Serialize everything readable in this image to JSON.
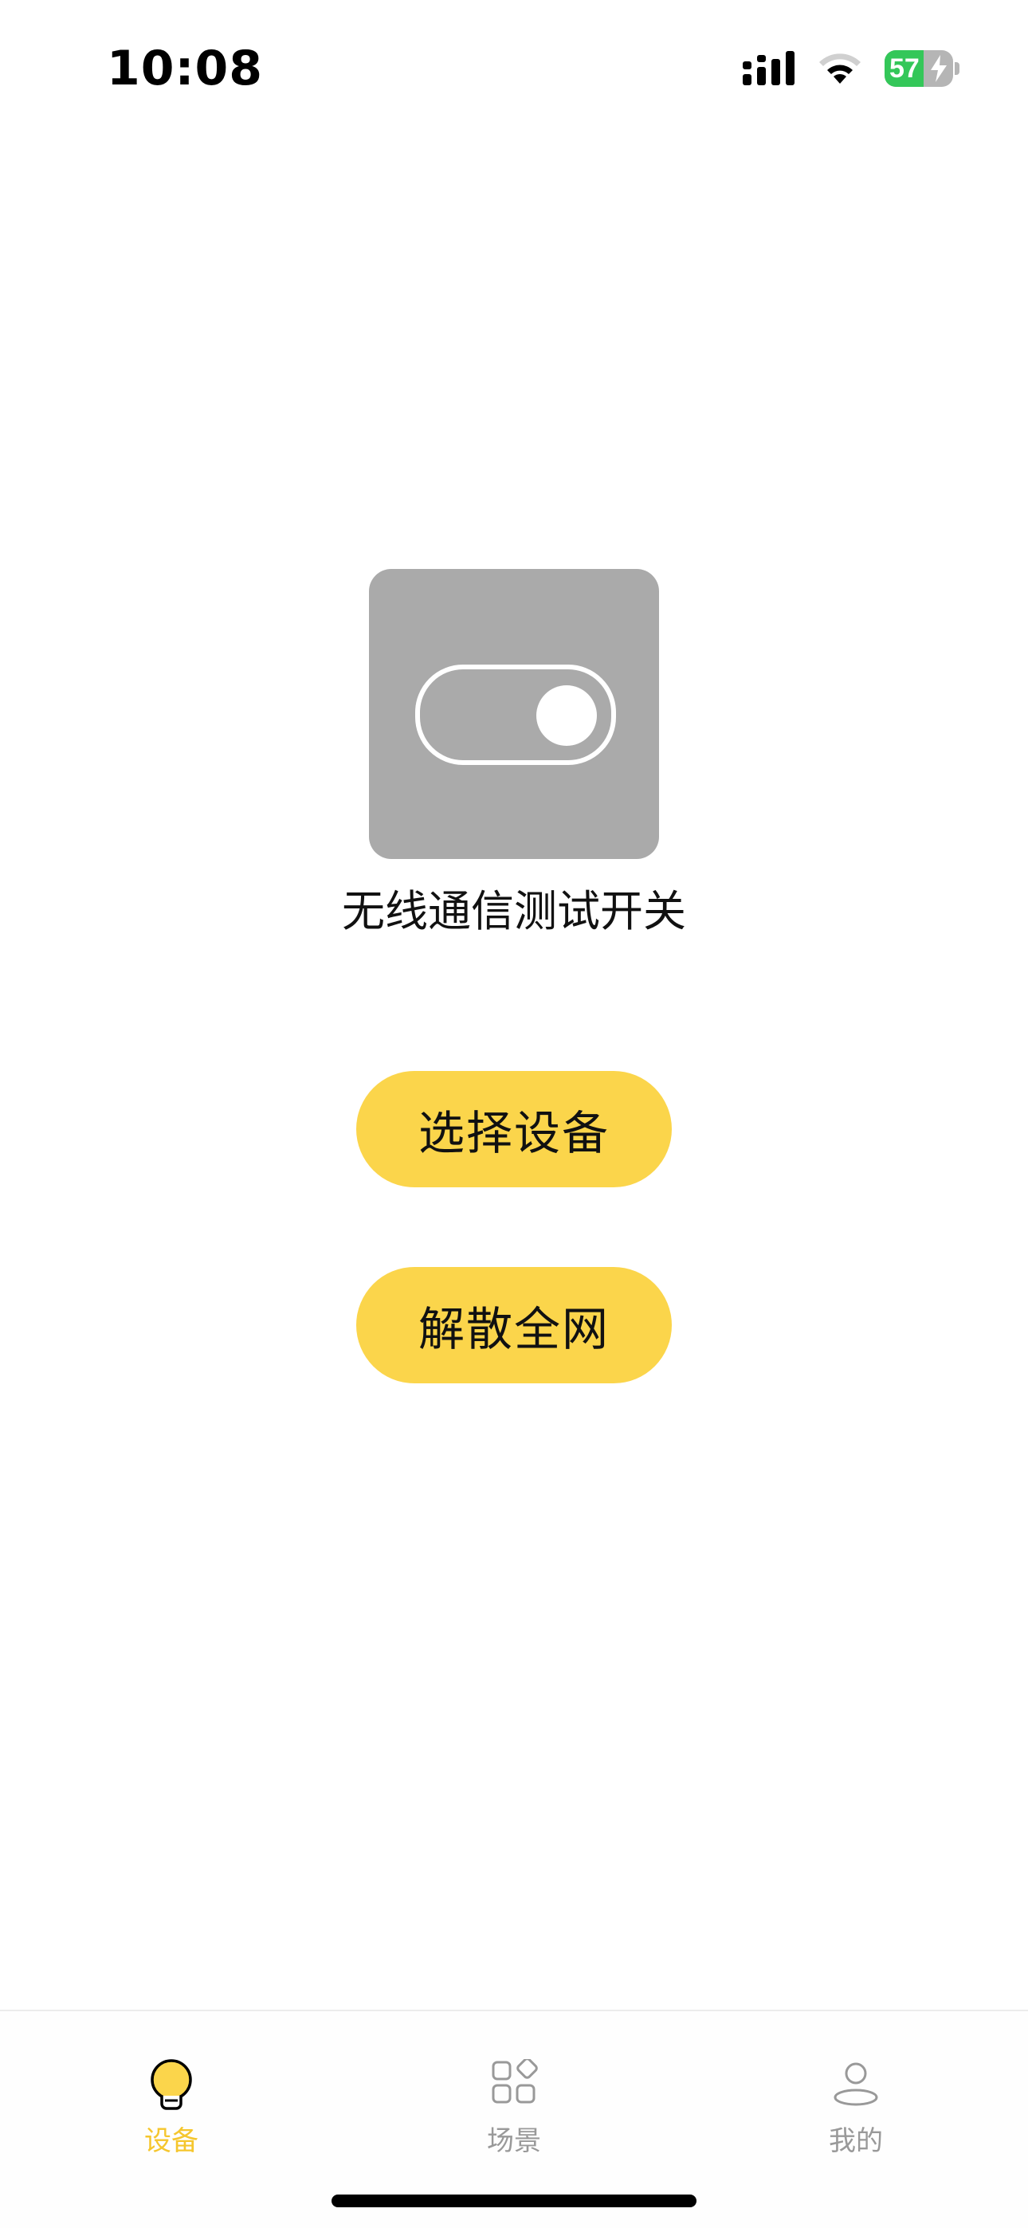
{
  "status_bar": {
    "time": "10:08",
    "battery_level": "57",
    "battery_fraction": 0.57,
    "icons": [
      "signal-icon",
      "wifi-icon",
      "battery-charging-icon"
    ]
  },
  "device": {
    "name": "无线通信测试开关",
    "icon": "toggle-switch-icon",
    "card_color": "#aaaaaa"
  },
  "actions": {
    "select_device_label": "选择设备",
    "dissolve_network_label": "解散全网",
    "button_color": "#fbd54b"
  },
  "tab_bar": {
    "active_color": "#f5c62d",
    "inactive_color": "#999999",
    "tabs": [
      {
        "label": "设备",
        "icon": "lightbulb-icon",
        "active": true
      },
      {
        "label": "场景",
        "icon": "scenes-grid-icon",
        "active": false
      },
      {
        "label": "我的",
        "icon": "user-profile-icon",
        "active": false
      }
    ]
  }
}
